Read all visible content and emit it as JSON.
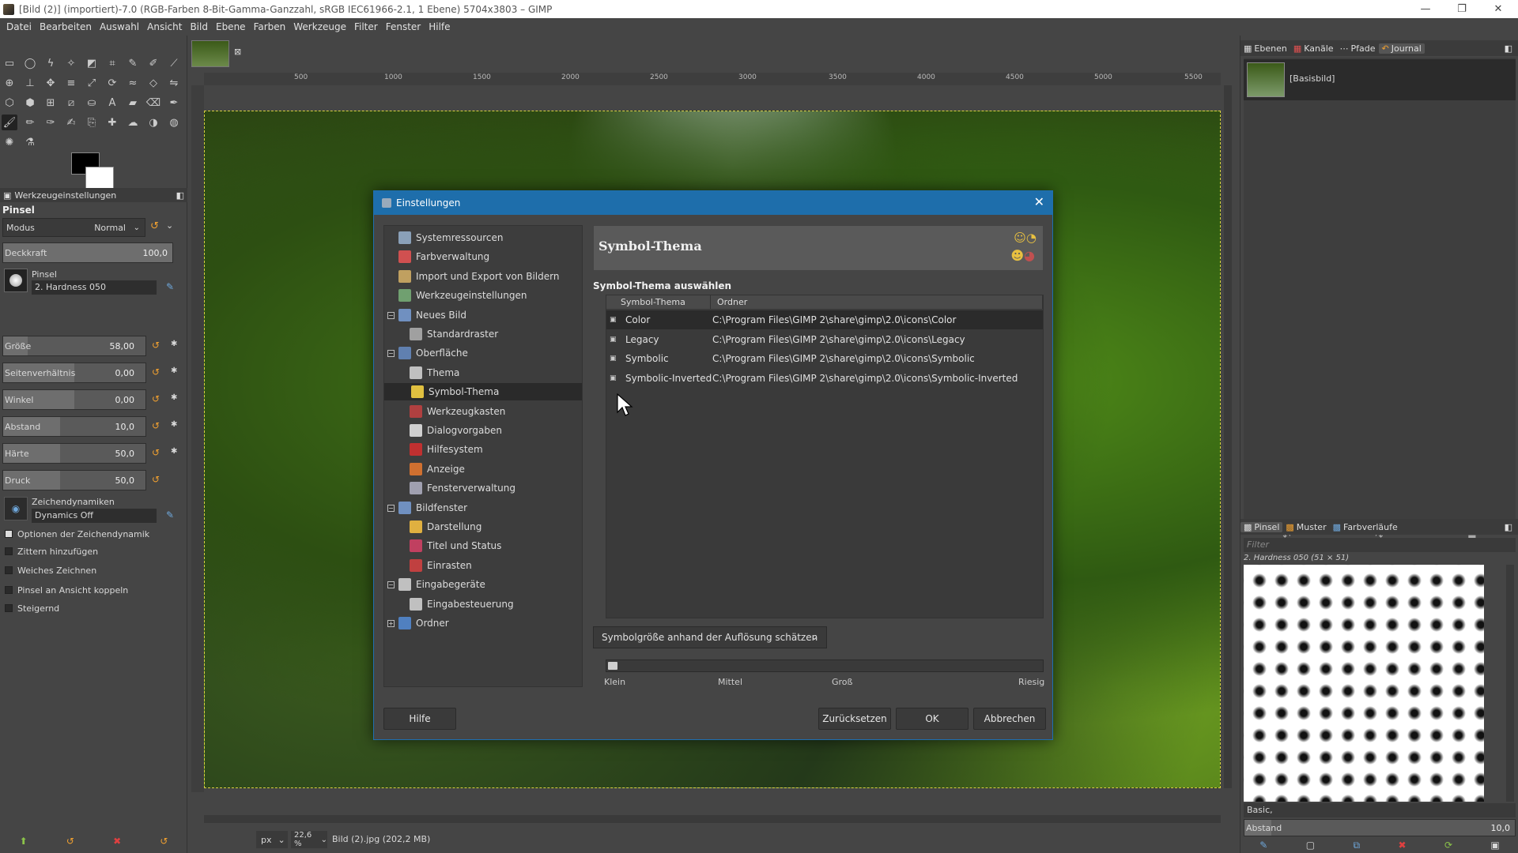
{
  "window": {
    "title": "[Bild (2)] (importiert)-7.0 (RGB-Farben 8-Bit-Gamma-Ganzzahl, sRGB IEC61966-2.1, 1 Ebene) 5704x3803 – GIMP"
  },
  "menu": [
    "Datei",
    "Bearbeiten",
    "Auswahl",
    "Ansicht",
    "Bild",
    "Ebene",
    "Farben",
    "Werkzeuge",
    "Filter",
    "Fenster",
    "Hilfe"
  ],
  "tool_options": {
    "panel_title": "Werkzeugeinstellungen",
    "tool_name": "Pinsel",
    "mode_label": "Modus",
    "mode_value": "Normal",
    "opacity_label": "Deckkraft",
    "opacity_value": "100,0",
    "brush_label": "Pinsel",
    "brush_value": "2. Hardness 050",
    "size_label": "Größe",
    "size_value": "58,00",
    "aspect_label": "Seitenverhältnis",
    "aspect_value": "0,00",
    "angle_label": "Winkel",
    "angle_value": "0,00",
    "spacing_label": "Abstand",
    "spacing_value": "10,0",
    "hardness_label": "Härte",
    "hardness_value": "50,0",
    "pressure_label": "Druck",
    "pressure_value": "50,0",
    "dynamics_label": "Zeichendynamiken",
    "dynamics_value": "Dynamics Off",
    "checks": [
      "Optionen der Zeichendynamik",
      "Zittern hinzufügen",
      "Weiches Zeichnen",
      "Pinsel an Ansicht koppeln",
      "Steigernd"
    ]
  },
  "ruler_ticks": [
    "500",
    "1000",
    "1500",
    "2000",
    "2500",
    "3000",
    "3500",
    "4000",
    "4500",
    "5000",
    "5500"
  ],
  "status": {
    "unit": "px",
    "zoom": "22,6 %",
    "file": "Bild (2).jpg (202,2 MB)"
  },
  "right_dock": {
    "tabs_top": [
      "Ebenen",
      "Kanäle",
      "Pfade",
      "Journal"
    ],
    "layer_name": "[Basisbild]",
    "tabs_brush": [
      "Pinsel",
      "Muster",
      "Farbverläufe"
    ],
    "filter_placeholder": "Filter",
    "brush_name": "2. Hardness 050 (51 × 51)",
    "preset": "Basic,",
    "spacing_label": "Abstand",
    "spacing_value": "10,0"
  },
  "dialog": {
    "title": "Einstellungen",
    "tree": [
      {
        "label": "Systemressourcen",
        "level": 0
      },
      {
        "label": "Farbverwaltung",
        "level": 0
      },
      {
        "label": "Import und Export von Bildern",
        "level": 0
      },
      {
        "label": "Werkzeugeinstellungen",
        "level": 0
      },
      {
        "label": "Neues Bild",
        "level": 0,
        "expander": "−"
      },
      {
        "label": "Standardraster",
        "level": 1
      },
      {
        "label": "Oberfläche",
        "level": 0,
        "expander": "−"
      },
      {
        "label": "Thema",
        "level": 1
      },
      {
        "label": "Symbol-Thema",
        "level": 1,
        "selected": true
      },
      {
        "label": "Werkzeugkasten",
        "level": 1
      },
      {
        "label": "Dialogvorgaben",
        "level": 1
      },
      {
        "label": "Hilfesystem",
        "level": 1
      },
      {
        "label": "Anzeige",
        "level": 1
      },
      {
        "label": "Fensterverwaltung",
        "level": 1
      },
      {
        "label": "Bildfenster",
        "level": 0,
        "expander": "−"
      },
      {
        "label": "Darstellung",
        "level": 1
      },
      {
        "label": "Titel und Status",
        "level": 1
      },
      {
        "label": "Einrasten",
        "level": 1
      },
      {
        "label": "Eingabegeräte",
        "level": 0,
        "expander": "−"
      },
      {
        "label": "Eingabesteuerung",
        "level": 1
      },
      {
        "label": "Ordner",
        "level": 0,
        "expander": "+"
      }
    ],
    "header": "Symbol-Thema",
    "section": "Symbol-Thema auswählen",
    "columns": [
      "Symbol-Thema",
      "Ordner"
    ],
    "themes": [
      {
        "name": "Color",
        "folder": "C:\\Program Files\\GIMP 2\\share\\gimp\\2.0\\icons\\Color",
        "selected": true
      },
      {
        "name": "Legacy",
        "folder": "C:\\Program Files\\GIMP 2\\share\\gimp\\2.0\\icons\\Legacy"
      },
      {
        "name": "Symbolic",
        "folder": "C:\\Program Files\\GIMP 2\\share\\gimp\\2.0\\icons\\Symbolic"
      },
      {
        "name": "Symbolic-Inverted",
        "folder": "C:\\Program Files\\GIMP 2\\share\\gimp\\2.0\\icons\\Symbolic-Inverted"
      }
    ],
    "estimate_label": "Symbolgröße anhand der Auflösung schätzen",
    "scale_labels": [
      "Klein",
      "Mittel",
      "Groß",
      "Riesig"
    ],
    "buttons": {
      "help": "Hilfe",
      "reset": "Zurücksetzen",
      "ok": "OK",
      "cancel": "Abbrechen"
    }
  },
  "colors": {
    "accent": "#1e6eab",
    "dock": "#454545",
    "dark": "#3a3a3a"
  }
}
